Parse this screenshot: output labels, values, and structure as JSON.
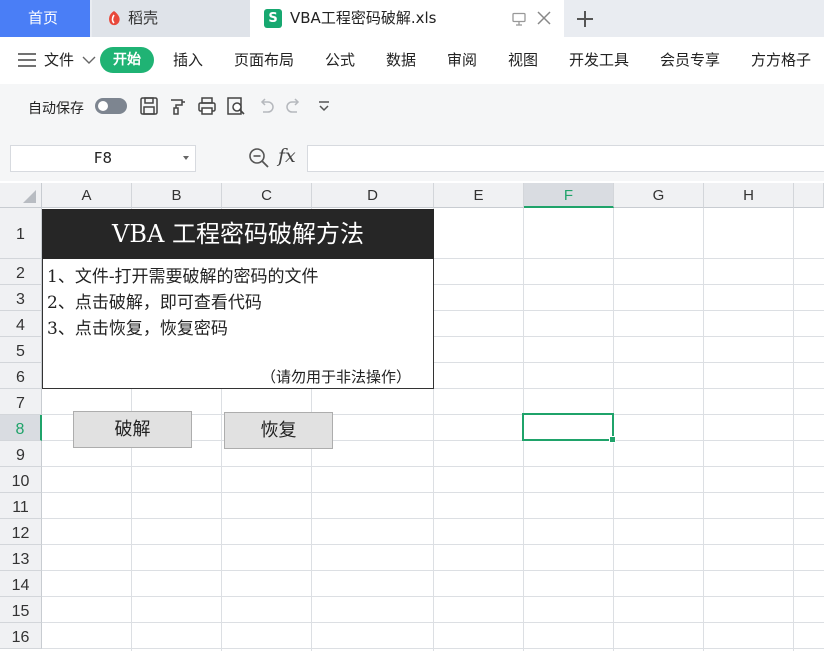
{
  "tabs": {
    "home": "首页",
    "docer": "稻壳",
    "file": "VBA工程密码破解.xls",
    "file_icon_letter": "S"
  },
  "ribbon": {
    "file_menu": "文件",
    "active_tab": "开始",
    "items": [
      "插入",
      "页面布局",
      "公式",
      "数据",
      "审阅",
      "视图",
      "开发工具",
      "会员专享",
      "方方格子"
    ]
  },
  "quickbar": {
    "autosave_label": "自动保存",
    "autosave_on": false
  },
  "formula_bar": {
    "name_box": "F8",
    "fx_label": "fx",
    "formula": ""
  },
  "sheet": {
    "columns": [
      "A",
      "B",
      "C",
      "D",
      "E",
      "F",
      "G",
      "H"
    ],
    "rows": [
      "1",
      "2",
      "3",
      "4",
      "5",
      "6",
      "7",
      "8",
      "9",
      "10",
      "11",
      "12",
      "13",
      "14",
      "15",
      "16"
    ],
    "selected_cell": "F8",
    "title": "VBA 工程密码破解方法",
    "lines": [
      "1、文件-打开需要破解的密码的文件",
      "2、点击破解，即可查看代码",
      "3、点击恢复，恢复密码"
    ],
    "note": "（请勿用于非法操作）",
    "buttons": {
      "crack": "破解",
      "restore": "恢复"
    }
  },
  "colors": {
    "accent_green": "#1fa36a",
    "home_tab_blue": "#4a7ef6",
    "title_fill": "#262626"
  }
}
